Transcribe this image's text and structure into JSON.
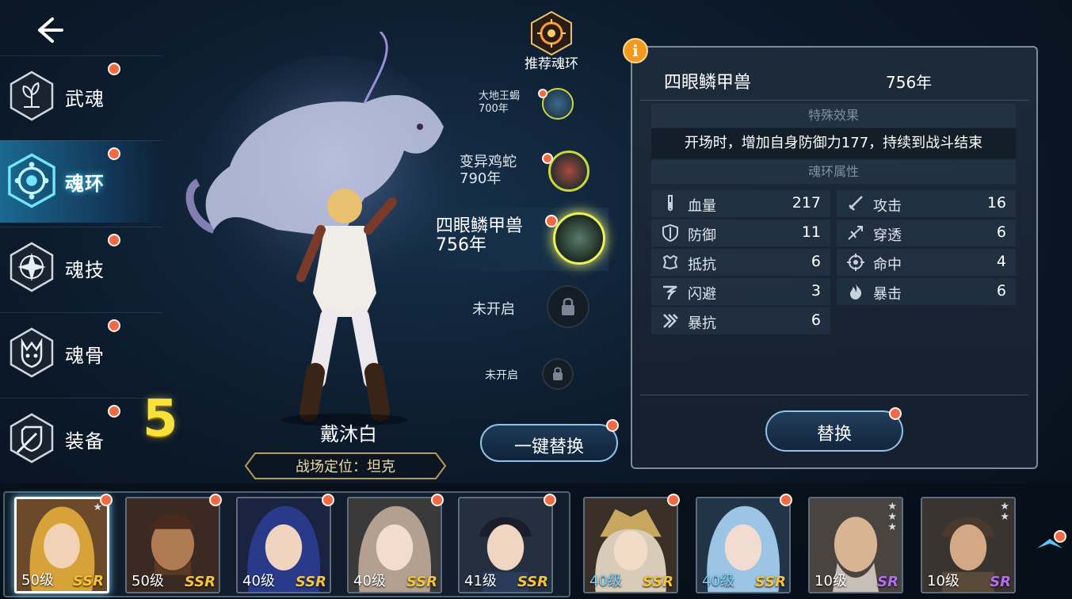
{
  "nav": {
    "back_icon": "back-arrow-icon"
  },
  "menu": [
    {
      "label": "武魂",
      "icon": "spirit-sprout-icon",
      "active": false
    },
    {
      "label": "魂环",
      "icon": "soul-ring-icon",
      "active": true
    },
    {
      "label": "魂技",
      "icon": "soul-skill-icon",
      "active": false
    },
    {
      "label": "魂骨",
      "icon": "soul-bone-icon",
      "active": false
    },
    {
      "label": "装备",
      "icon": "equipment-shield-icon",
      "active": false
    }
  ],
  "level_number": "5",
  "character": {
    "name": "戴沐白",
    "role": "战场定位：坦克"
  },
  "recommend": {
    "label": "推荐魂环",
    "icon": "recommend-ring-icon"
  },
  "rings": [
    {
      "name": "大地王蝎",
      "years": "700年"
    },
    {
      "name": "变异鸡蛇",
      "years": "790年"
    },
    {
      "name": "四眼鳞甲兽",
      "years": "756年"
    }
  ],
  "locked": [
    {
      "label": "未开启"
    },
    {
      "label": "未开启"
    }
  ],
  "one_key_label": "一键替换",
  "panel": {
    "info_badge": "i",
    "name": "四眼鳞甲兽",
    "years": "756年",
    "special_title": "特殊效果",
    "special_text": "开场时，增加自身防御力177，持续到战斗结束",
    "attr_title": "魂环属性",
    "stats": [
      {
        "label": "血量",
        "value": "217",
        "icon": "hp-vial-icon"
      },
      {
        "label": "攻击",
        "value": "16",
        "icon": "attack-sword-icon"
      },
      {
        "label": "防御",
        "value": "11",
        "icon": "defense-shield-icon"
      },
      {
        "label": "穿透",
        "value": "6",
        "icon": "penetration-icon"
      },
      {
        "label": "抵抗",
        "value": "6",
        "icon": "resist-icon"
      },
      {
        "label": "命中",
        "value": "4",
        "icon": "hit-target-icon"
      },
      {
        "label": "闪避",
        "value": "3",
        "icon": "dodge-wind-icon"
      },
      {
        "label": "暴击",
        "value": "6",
        "icon": "crit-flame-icon"
      },
      {
        "label": "暴抗",
        "value": "6",
        "icon": "crit-resist-icon"
      }
    ],
    "replace_label": "替换"
  },
  "roster": [
    {
      "level": "50级",
      "rank": "SSR",
      "selected": true,
      "star": true
    },
    {
      "level": "50级",
      "rank": "SSR",
      "selected": false
    },
    {
      "level": "40级",
      "rank": "SSR",
      "selected": false
    },
    {
      "level": "40级",
      "rank": "SSR",
      "selected": false
    },
    {
      "level": "41级",
      "rank": "SSR",
      "selected": false
    },
    {
      "level": "40级",
      "rank": "SSR",
      "selected": false
    },
    {
      "level": "40级",
      "rank": "SSR",
      "selected": false
    },
    {
      "level": "10级",
      "rank": "SR",
      "selected": false
    },
    {
      "level": "10级",
      "rank": "SR",
      "selected": false
    }
  ],
  "colors": {
    "accent": "#2aa8e6",
    "notify": "#f26a45",
    "ssr": "#f5c430",
    "sr": "#b56cf2",
    "level_number": "#f8e23a"
  }
}
